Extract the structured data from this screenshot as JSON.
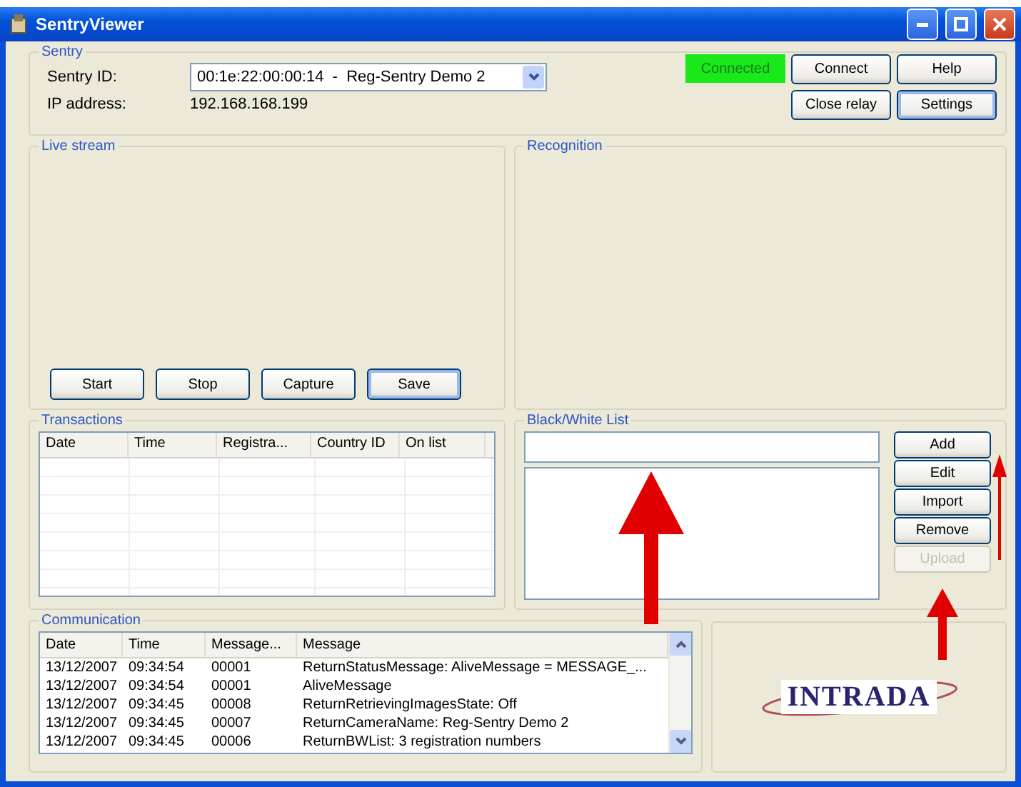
{
  "window": {
    "title": "SentryViewer"
  },
  "sentry": {
    "title": "Sentry",
    "id_label": "Sentry ID:",
    "id_value": "00:1e:22:00:00:14  -  Reg-Sentry Demo 2",
    "ip_label": "IP address:",
    "ip_value": "192.168.168.199",
    "status": "Connected",
    "connected": true,
    "buttons": [
      {
        "label": "Connect",
        "default": false
      },
      {
        "label": "Help",
        "default": false
      },
      {
        "label": "Close relay",
        "default": false
      },
      {
        "label": "Settings",
        "default": true
      }
    ]
  },
  "live_stream": {
    "title": "Live stream",
    "buttons": [
      {
        "label": "Start",
        "default": false
      },
      {
        "label": "Stop",
        "default": false
      },
      {
        "label": "Capture",
        "default": false
      },
      {
        "label": "Save",
        "default": true
      }
    ]
  },
  "recognition": {
    "title": "Recognition"
  },
  "transactions": {
    "title": "Transactions",
    "columns": [
      "Date",
      "Time",
      "Registra...",
      "Country ID",
      "On list"
    ]
  },
  "bw_list": {
    "title": "Black/White List",
    "buttons": [
      {
        "label": "Add",
        "disabled": false
      },
      {
        "label": "Edit",
        "disabled": false
      },
      {
        "label": "Import",
        "disabled": false
      },
      {
        "label": "Remove",
        "disabled": false
      },
      {
        "label": "Upload",
        "disabled": true
      }
    ]
  },
  "communication": {
    "title": "Communication",
    "columns": [
      "Date",
      "Time",
      "Message...",
      "Message"
    ],
    "rows": [
      [
        "13/12/2007",
        "09:34:54",
        "00001",
        "ReturnStatusMessage: AliveMessage = MESSAGE_..."
      ],
      [
        "13/12/2007",
        "09:34:54",
        "00001",
        "AliveMessage"
      ],
      [
        "13/12/2007",
        "09:34:45",
        "00008",
        "ReturnRetrievingImagesState: Off"
      ],
      [
        "13/12/2007",
        "09:34:45",
        "00007",
        "ReturnCameraName: Reg-Sentry Demo 2"
      ],
      [
        "13/12/2007",
        "09:34:45",
        "00006",
        "ReturnBWList: 3 registration numbers"
      ]
    ]
  },
  "logo": "INTRADA"
}
